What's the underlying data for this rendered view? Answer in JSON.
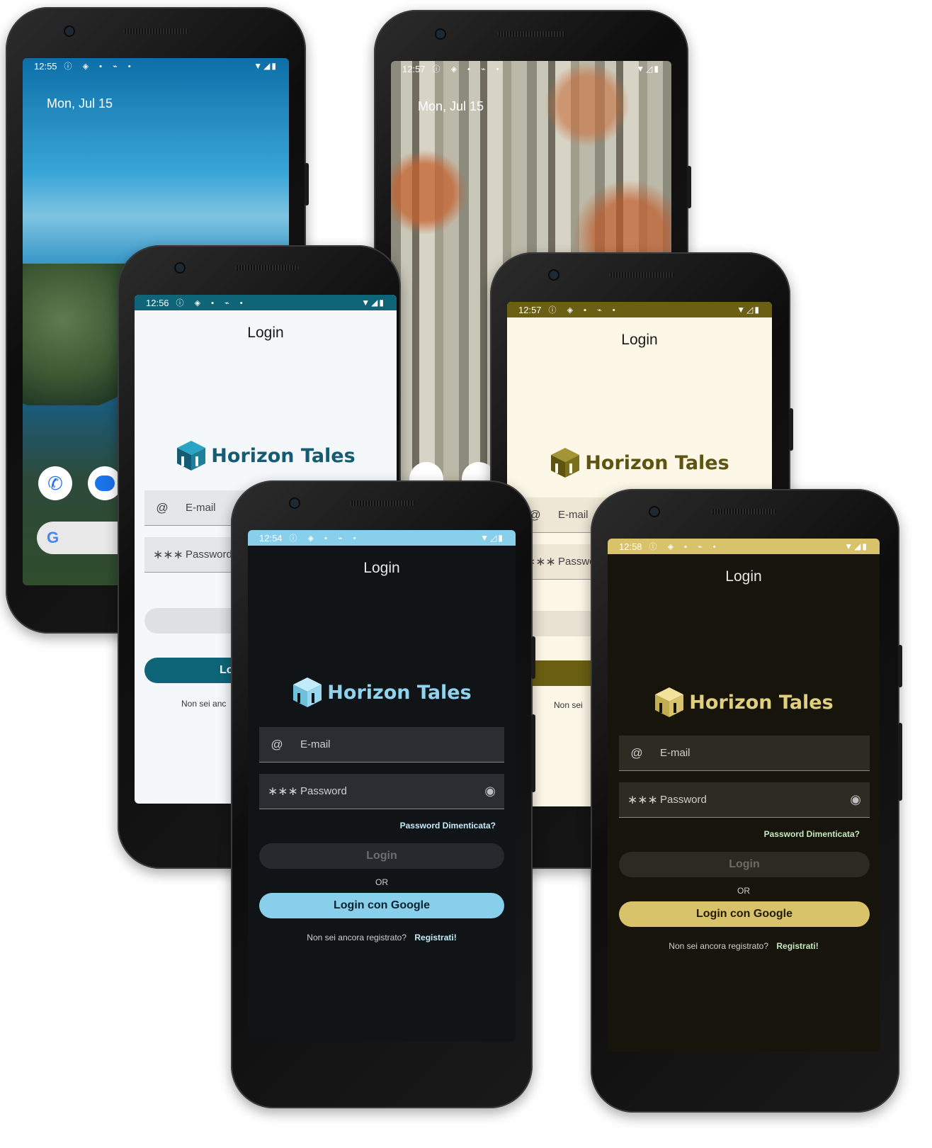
{
  "home1": {
    "time": "12:55",
    "date": "Mon, Jul 15",
    "icons": [
      "info-icon",
      "shield-icon",
      "sdcard-icon",
      "download-icon",
      "dot-icon"
    ],
    "dock": [
      "phone-icon",
      "messages-icon"
    ],
    "search_logo": "G"
  },
  "home2": {
    "time": "12:57",
    "date": "Mon, Jul 15"
  },
  "login_light_teal": {
    "time": "12:56",
    "title": "Login",
    "brand": "Horizon Tales",
    "email_placeholder": "E-mail",
    "password_placeholder": "Password",
    "login_label": "Lo",
    "register_prompt": "Non sei anc",
    "colors": {
      "status": "#0f6578",
      "bg": "#f4f8fa",
      "primary": "#0f6578"
    }
  },
  "login_light_olive": {
    "time": "12:57",
    "title": "Login",
    "brand": "Horizon Tales",
    "email_placeholder": "E-mail",
    "password_placeholder": "Passwo",
    "register_prompt": "Non sei",
    "colors": {
      "status": "#6b5f13",
      "bg": "#fdf7e7",
      "primary": "#6b5f13"
    }
  },
  "login_dark_blue": {
    "time": "12:54",
    "title": "Login",
    "brand": "Horizon Tales",
    "email_placeholder": "E-mail",
    "password_placeholder": "Password",
    "forgot": "Password Dimenticata?",
    "login_button": "Login",
    "or": "OR",
    "google_button": "Login con Google",
    "register_prompt": "Non sei ancora registrato?",
    "register_link": "Registrati!",
    "colors": {
      "status": "#87cfea",
      "bg": "#111417",
      "primary": "#87cfea"
    }
  },
  "login_dark_gold": {
    "time": "12:58",
    "title": "Login",
    "brand": "Horizon Tales",
    "email_placeholder": "E-mail",
    "password_placeholder": "Password",
    "forgot": "Password Dimenticata?",
    "login_button": "Login",
    "or": "OR",
    "google_button": "Login con Google",
    "register_prompt": "Non sei ancora registrato?",
    "register_link": "Registrati!",
    "colors": {
      "status": "#d8c36a",
      "bg": "#17140c",
      "primary": "#d8c36a"
    }
  }
}
